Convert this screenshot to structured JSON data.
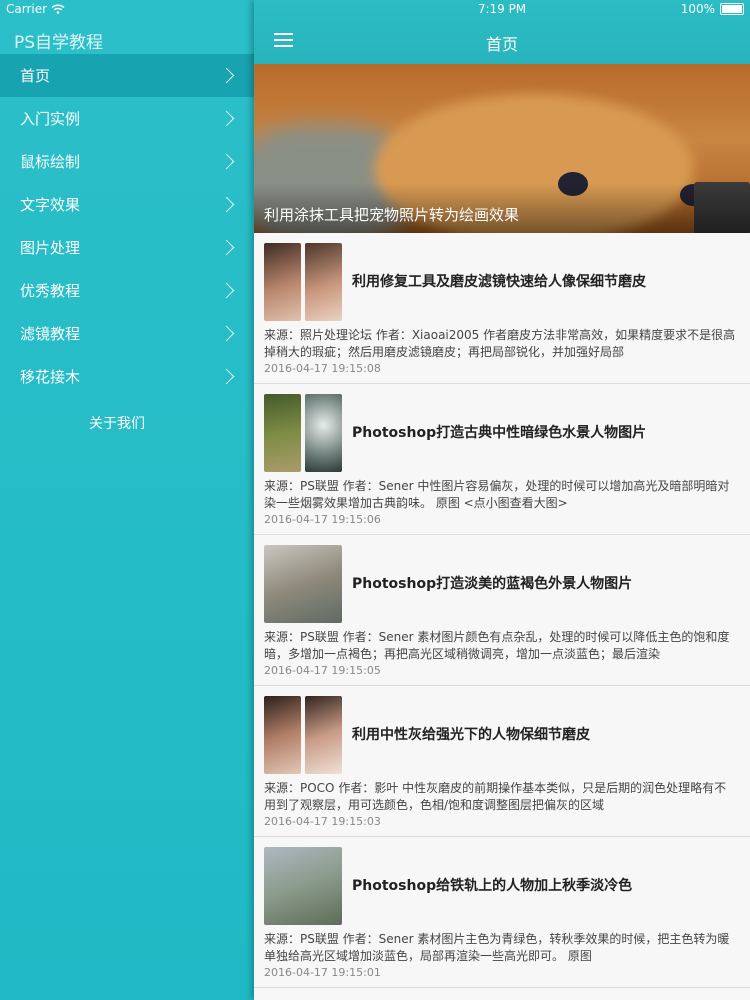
{
  "status_bar": {
    "carrier": "Carrier",
    "time": "7:19 PM",
    "battery": "100%"
  },
  "sidebar": {
    "title": "PS自学教程",
    "items": [
      {
        "label": "首页",
        "active": true
      },
      {
        "label": "入门实例",
        "active": false
      },
      {
        "label": "鼠标绘制",
        "active": false
      },
      {
        "label": "文字效果",
        "active": false
      },
      {
        "label": "图片处理",
        "active": false
      },
      {
        "label": "优秀教程",
        "active": false
      },
      {
        "label": "滤镜教程",
        "active": false
      },
      {
        "label": "移花接木",
        "active": false
      }
    ],
    "about": "关于我们"
  },
  "header": {
    "title": "首页",
    "menu_icon": "hamburger-icon"
  },
  "banner": {
    "caption": "利用涂抹工具把宠物照片转为绘画效果"
  },
  "articles": [
    {
      "title": "利用修复工具及磨皮滤镜快速给人像保细节磨皮",
      "desc1": "来源：照片处理论坛 作者：Xiaoai2005 作者磨皮方法非常高效，如果精度要求不是很高",
      "desc2": "掉稍大的瑕疵；然后用磨皮滤镜磨皮；再把局部锐化，并加强好局部",
      "date": "2016-04-17 19:15:08"
    },
    {
      "title": "Photoshop打造古典中性暗绿色水景人物图片",
      "desc1": "来源：PS联盟 作者：Sener 中性图片容易偏灰，处理的时候可以增加高光及暗部明暗对",
      "desc2": "染一些烟雾效果增加古典韵味。 原图 <点小图查看大图>",
      "date": "2016-04-17 19:15:06"
    },
    {
      "title": "Photoshop打造淡美的蓝褐色外景人物图片",
      "desc1": "来源：PS联盟 作者：Sener 素材图片颜色有点杂乱，处理的时候可以降低主色的饱和度",
      "desc2": "暗，多增加一点褐色；再把高光区域稍微调亮，增加一点淡蓝色；最后渲染",
      "date": "2016-04-17 19:15:05"
    },
    {
      "title": "利用中性灰给强光下的人物保细节磨皮",
      "desc1": "来源：POCO 作者：影叶 中性灰磨皮的前期操作基本类似，只是后期的润色处理略有不",
      "desc2": "用到了观察层，用可选颜色，色相/饱和度调整图层把偏灰的区域",
      "date": "2016-04-17 19:15:03"
    },
    {
      "title": "Photoshop给铁轨上的人物加上秋季淡冷色",
      "desc1": "来源：PS联盟 作者：Sener 素材图片主色为青绿色，转秋季效果的时候，把主色转为暖",
      "desc2": "单独给高光区域增加淡蓝色，局部再渲染一些高光即可。 原图",
      "date": "2016-04-17 19:15:01"
    }
  ]
}
